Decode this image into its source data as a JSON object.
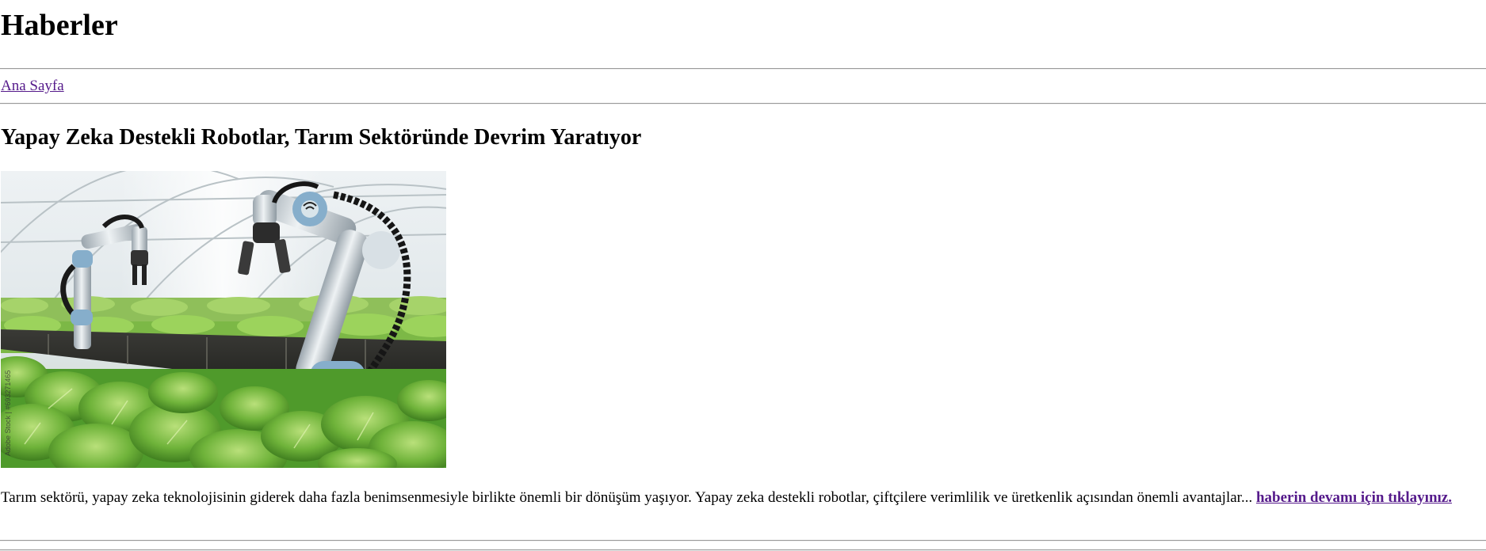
{
  "page": {
    "heading": "Haberler",
    "nav": {
      "home_label": "Ana Sayfa"
    }
  },
  "article": {
    "title": "Yapay Zeka Destekli Robotlar, Tarım Sektöründe Devrim Yaratıyor",
    "image": {
      "subject": "robotic-arms-greenhouse-photo",
      "watermark": "Adobe Stock | #693271465"
    },
    "summary": "Tarım sektörü, yapay zeka teknolojisinin giderek daha fazla benimsenmesiyle birlikte önemli bir dönüşüm yaşıyor. Yapay zeka destekli robotlar, çiftçilere verimlilik ve üretkenlik açısından önemli avantajlar... ",
    "read_more_label": "haberin devamı için tıklayınız."
  },
  "colors": {
    "visited_link": "#551a8b",
    "rule": "#9a9a9a"
  }
}
